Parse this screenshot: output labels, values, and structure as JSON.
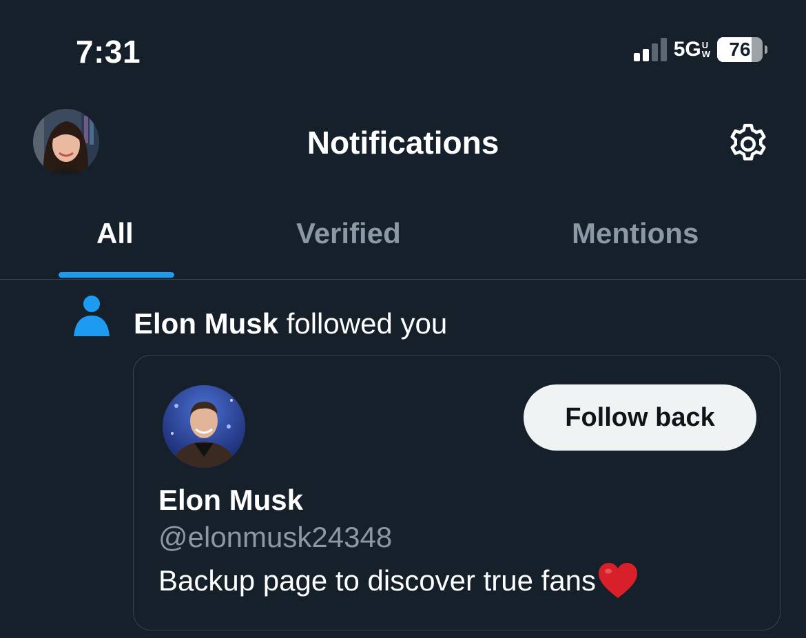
{
  "status_bar": {
    "time": "7:31",
    "network": "5G",
    "network_sub_top": "U",
    "network_sub_bottom": "W",
    "battery_percent": "76",
    "signal_bars_active": 2,
    "signal_bars_total": 4
  },
  "header": {
    "title": "Notifications",
    "avatar_icon": "profile-avatar",
    "settings_icon": "gear-icon"
  },
  "tabs": [
    {
      "label": "All",
      "active": true
    },
    {
      "label": "Verified",
      "active": false
    },
    {
      "label": "Mentions",
      "active": false
    }
  ],
  "notification": {
    "icon": "person-icon",
    "actor_name": "Elon Musk",
    "action_text": " followed you",
    "card": {
      "follow_button_label": "Follow back",
      "display_name": "Elon Musk",
      "handle": "@elonmusk24348",
      "bio": "Backup page to discover true fans",
      "bio_emoji": "heart-icon"
    }
  },
  "colors": {
    "background": "#15202b",
    "accent": "#1d9bf0",
    "secondary_text": "#8b98a5",
    "divider": "#38444d",
    "heart": "#d8202b"
  }
}
